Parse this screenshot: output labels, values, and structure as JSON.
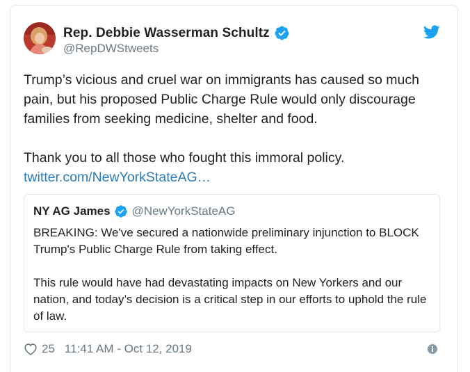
{
  "author": {
    "name": "Rep. Debbie Wasserman Schultz",
    "handle": "@RepDWStweets",
    "verified": true
  },
  "tweet": {
    "paragraph_1": "Trump’s vicious and cruel war on immigrants has caused so much pain, but his proposed Public Charge Rule would only discourage families from seeking medicine, shelter and food.",
    "paragraph_2": "Thank you to all those who fought this immoral policy.",
    "link_text": "twitter.com/NewYorkStateAG…"
  },
  "quoted_tweet": {
    "name": "NY AG James",
    "handle": "@NewYorkStateAG",
    "verified": true,
    "paragraph_1": "BREAKING: We've secured a nationwide preliminary injunction to BLOCK Trump's Public Charge Rule from taking effect.",
    "paragraph_2": "This rule would have had devastating impacts on New Yorkers and our nation, and today’s decision is a critical step in our efforts to uphold the rule of law."
  },
  "footer": {
    "like_count": "25",
    "timestamp": "11:41 AM - Oct 12, 2019"
  },
  "icons": {
    "brand": "twitter-bird-icon",
    "verified": "verified-badge-icon",
    "like": "heart-icon",
    "info": "info-icon"
  },
  "colors": {
    "twitter_blue": "#1da1f2",
    "link": "#2b7bb9",
    "text": "#1c2022",
    "secondary_text": "#697882",
    "border": "#e1e8ed"
  }
}
